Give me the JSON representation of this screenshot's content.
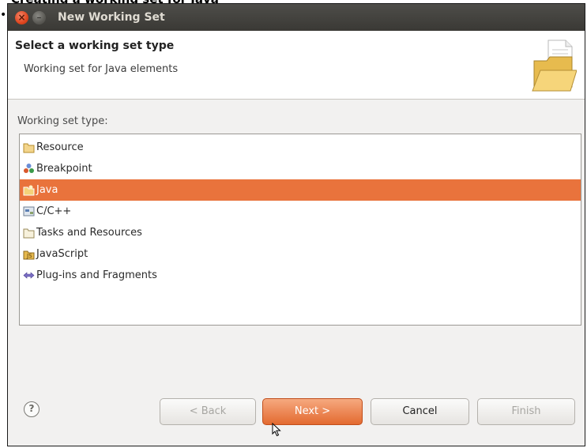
{
  "page": {
    "top_text": "Creating a working set for Java"
  },
  "window": {
    "title": "New Working Set",
    "close_symbol": "×",
    "minimize_symbol": "–"
  },
  "header": {
    "title": "Select a working set type",
    "description": "Working set for Java elements",
    "icon": "folder-icon"
  },
  "list_label": "Working set type:",
  "types": [
    {
      "label": "Resource",
      "icon": "resource-folder-icon"
    },
    {
      "label": "Breakpoint",
      "icon": "breakpoint-icon"
    },
    {
      "label": "Java",
      "icon": "java-package-icon",
      "selected": true
    },
    {
      "label": "C/C++",
      "icon": "cpp-icon"
    },
    {
      "label": "Tasks and Resources",
      "icon": "tasks-folder-icon"
    },
    {
      "label": "JavaScript",
      "icon": "javascript-icon"
    },
    {
      "label": "Plug-ins and Fragments",
      "icon": "plugin-icon"
    }
  ],
  "buttons": {
    "help": "?",
    "back": "< Back",
    "next": "Next >",
    "cancel": "Cancel",
    "finish": "Finish"
  },
  "colors": {
    "selection": "#e9733c",
    "titlebar": "#3c3b37",
    "dialog_bg": "#f2f1f0"
  }
}
